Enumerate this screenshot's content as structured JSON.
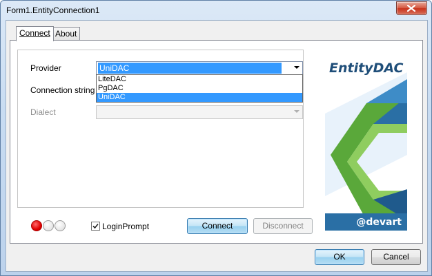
{
  "window": {
    "title": "Form1.EntityConnection1"
  },
  "tabs": [
    {
      "label": "Connect",
      "active": true
    },
    {
      "label": "About",
      "active": false
    }
  ],
  "form": {
    "provider_label": "Provider",
    "provider_value": "UniDAC",
    "provider_options": [
      "LiteDAC",
      "PgDAC",
      "UniDAC"
    ],
    "provider_selected_index": 2,
    "connection_string_label": "Connection string",
    "dialect_label": "Dialect",
    "dialect_value": ""
  },
  "status_lights": [
    {
      "state": "on",
      "color": "#e00000"
    },
    {
      "state": "off",
      "color": "#d9d9d9"
    },
    {
      "state": "off",
      "color": "#d9d9d9"
    }
  ],
  "login_prompt": {
    "label": "LoginPrompt",
    "checked": true
  },
  "buttons": {
    "connect": "Connect",
    "disconnect": "Disconnect",
    "ok": "OK",
    "cancel": "Cancel"
  },
  "logo": {
    "title": "EntityDAC",
    "brand": "@devart"
  },
  "colors": {
    "accent": "#3399ff",
    "logo_blue": "#2a6fa5",
    "logo_green": "#5aa83a"
  },
  "icons": {
    "close": "close-icon",
    "check": "check-icon"
  }
}
